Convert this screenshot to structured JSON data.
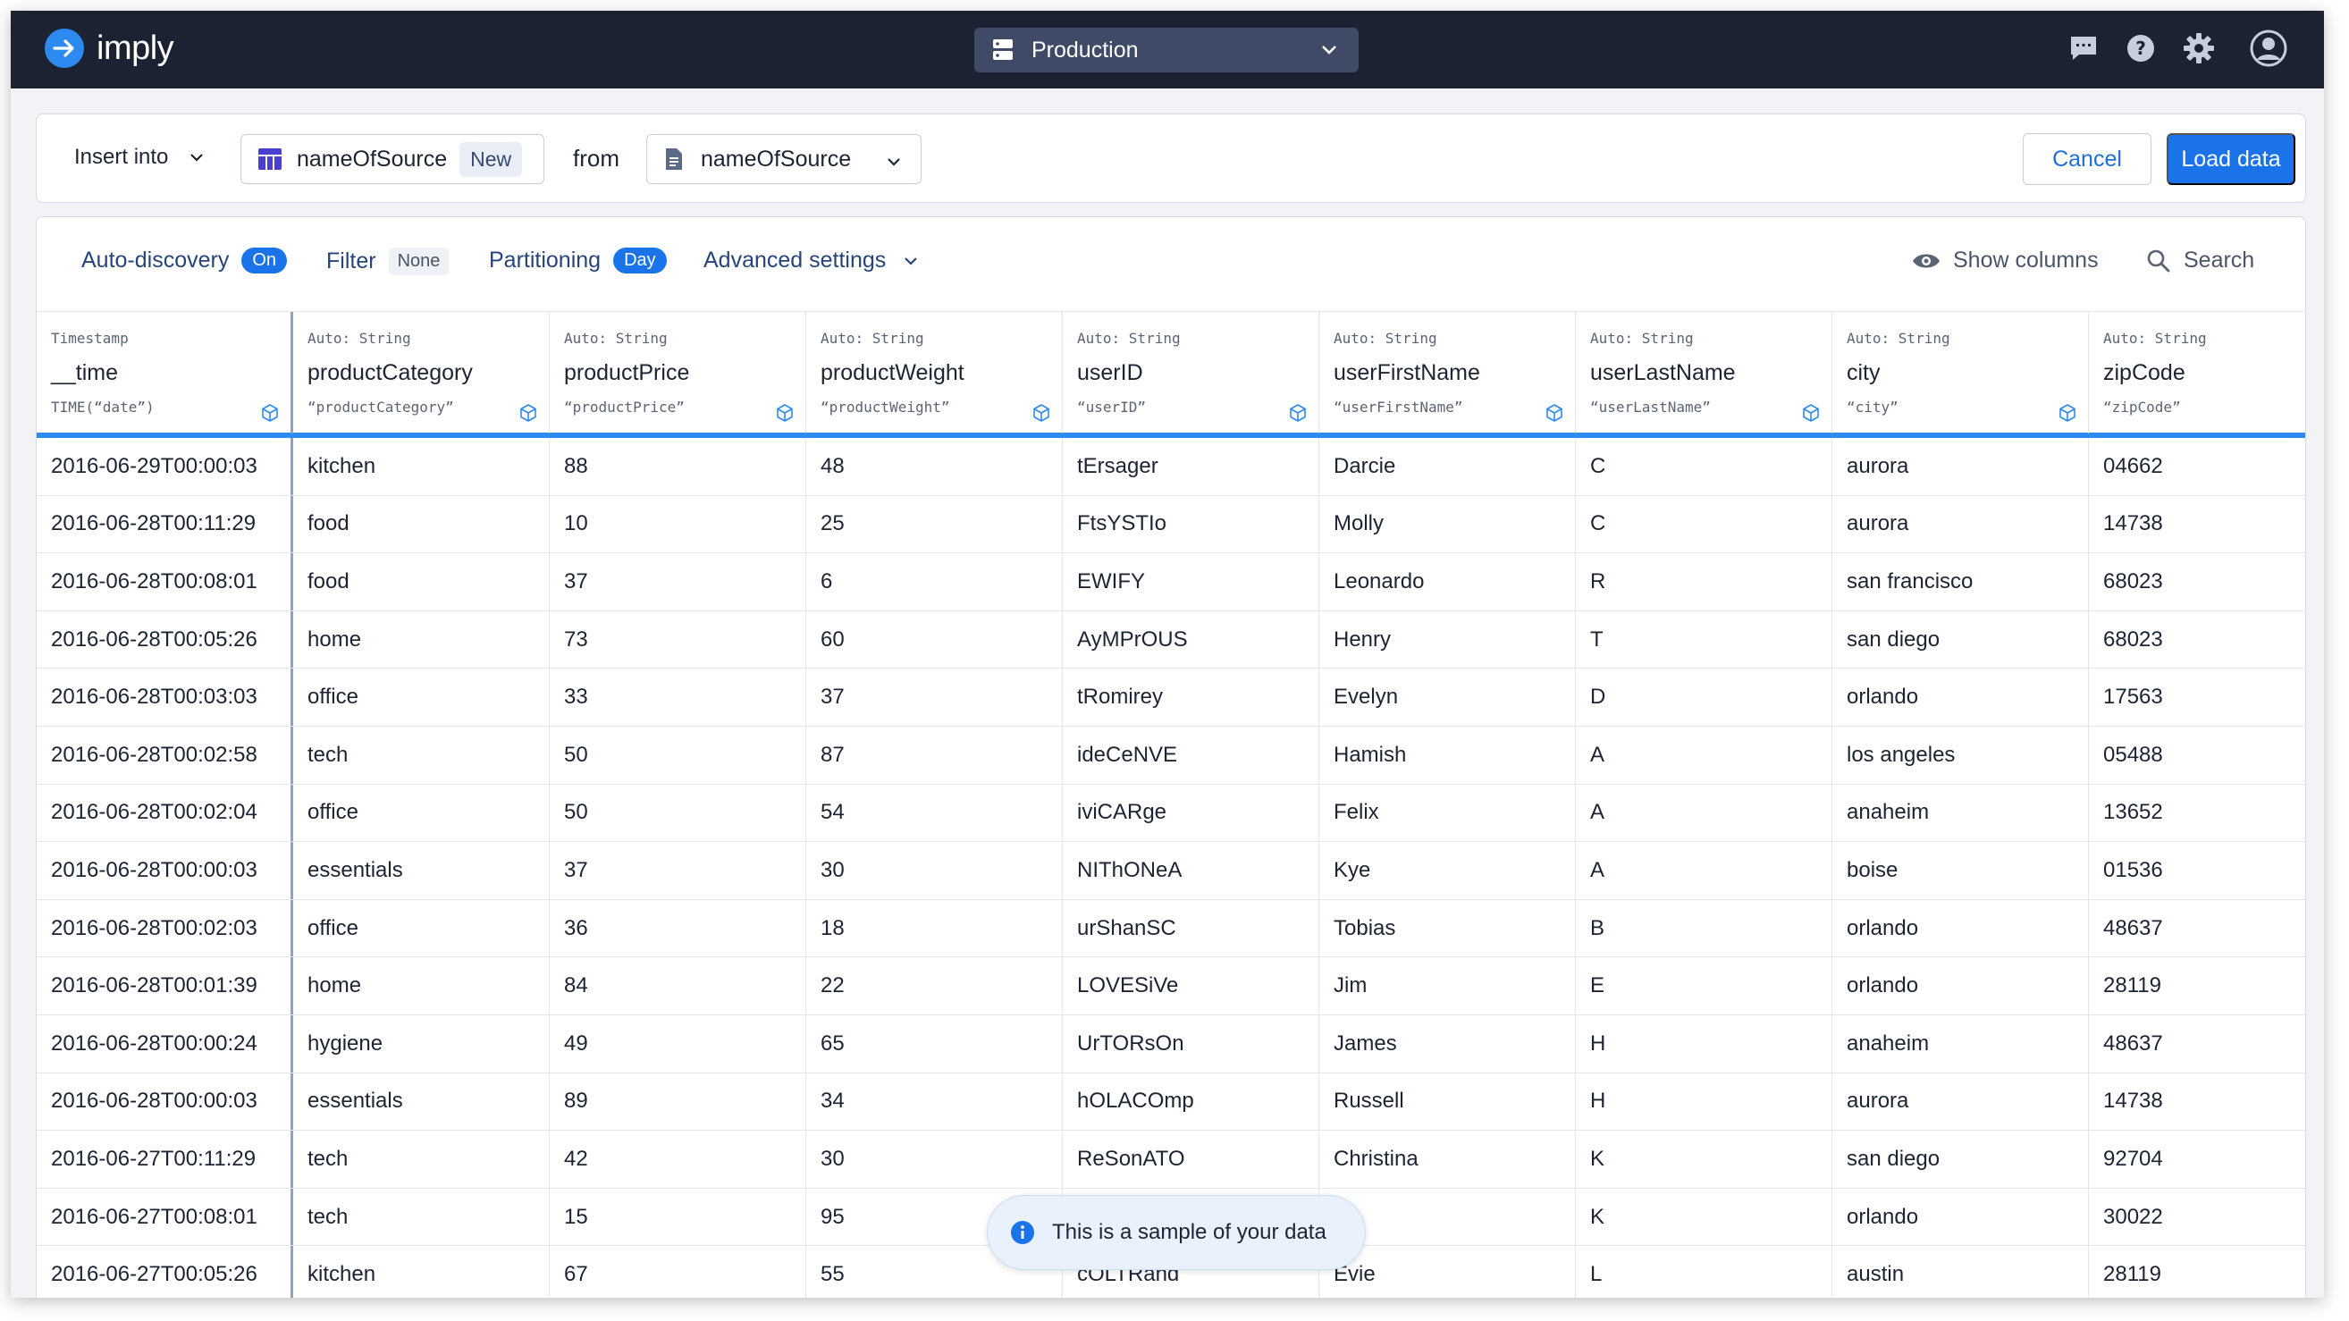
{
  "app": {
    "name": "imply"
  },
  "header": {
    "environment": "Production"
  },
  "insert_bar": {
    "insert_label": "Insert into",
    "target_table": "nameOfSource",
    "new_badge": "New",
    "from_label": "from",
    "source": "nameOfSource",
    "cancel_label": "Cancel",
    "load_label": "Load data"
  },
  "toolbar": {
    "auto_discovery": "Auto-discovery",
    "auto_discovery_state": "On",
    "filter": "Filter",
    "filter_state": "None",
    "partitioning": "Partitioning",
    "partitioning_state": "Day",
    "advanced": "Advanced settings",
    "show_columns": "Show columns",
    "search": "Search"
  },
  "columns": [
    {
      "type": "Timestamp",
      "name": "__time",
      "expr": "TIME(“date”)"
    },
    {
      "type": "Auto: String",
      "name": "productCategory",
      "expr": "“productCategory”"
    },
    {
      "type": "Auto: String",
      "name": "productPrice",
      "expr": "“productPrice”"
    },
    {
      "type": "Auto: String",
      "name": "productWeight",
      "expr": "“productWeight”"
    },
    {
      "type": "Auto: String",
      "name": "userID",
      "expr": "“userID”"
    },
    {
      "type": "Auto: String",
      "name": "userFirstName",
      "expr": "“userFirstName”"
    },
    {
      "type": "Auto: String",
      "name": "userLastName",
      "expr": "“userLastName”"
    },
    {
      "type": "Auto: String",
      "name": "city",
      "expr": "“city”"
    },
    {
      "type": "Auto: String",
      "name": "zipCode",
      "expr": "“zipCode”"
    }
  ],
  "rows": [
    [
      "2016-06-29T00:00:03",
      "kitchen",
      "88",
      "48",
      "tErsager",
      "Darcie",
      "C",
      "aurora",
      "04662"
    ],
    [
      "2016-06-28T00:11:29",
      "food",
      "10",
      "25",
      "FtsYSTIo",
      "Molly",
      "C",
      "aurora",
      "14738"
    ],
    [
      "2016-06-28T00:08:01",
      "food",
      "37",
      "6",
      "EWIFY",
      "Leonardo",
      "R",
      "san francisco",
      "68023"
    ],
    [
      "2016-06-28T00:05:26",
      "home",
      "73",
      "60",
      "AyMPrOUS",
      "Henry",
      "T",
      "san diego",
      "68023"
    ],
    [
      "2016-06-28T00:03:03",
      "office",
      "33",
      "37",
      "tRomirey",
      "Evelyn",
      "D",
      "orlando",
      "17563"
    ],
    [
      "2016-06-28T00:02:58",
      "tech",
      "50",
      "87",
      "ideCeNVE",
      "Hamish",
      "A",
      "los angeles",
      "05488"
    ],
    [
      "2016-06-28T00:02:04",
      "office",
      "50",
      "54",
      "iviCARge",
      "Felix",
      "A",
      "anaheim",
      "13652"
    ],
    [
      "2016-06-28T00:00:03",
      "essentials",
      "37",
      "30",
      "NIThONeA",
      "Kye",
      "A",
      "boise",
      "01536"
    ],
    [
      "2016-06-28T00:02:03",
      "office",
      "36",
      "18",
      "urShanSC",
      "Tobias",
      "B",
      "orlando",
      "48637"
    ],
    [
      "2016-06-28T00:01:39",
      "home",
      "84",
      "22",
      "LOVESiVe",
      "Jim",
      "E",
      "orlando",
      "28119"
    ],
    [
      "2016-06-28T00:00:24",
      "hygiene",
      "49",
      "65",
      "UrTORsOn",
      "James",
      "H",
      "anaheim",
      "48637"
    ],
    [
      "2016-06-28T00:00:03",
      "essentials",
      "89",
      "34",
      "hOLACOmp",
      "Russell",
      "H",
      "aurora",
      "14738"
    ],
    [
      "2016-06-27T00:11:29",
      "tech",
      "42",
      "30",
      "ReSonATO",
      "Christina",
      "K",
      "san diego",
      "92704"
    ],
    [
      "2016-06-27T00:08:01",
      "tech",
      "15",
      "95",
      "",
      "na",
      "K",
      "orlando",
      "30022"
    ],
    [
      "2016-06-27T00:05:26",
      "kitchen",
      "67",
      "55",
      "cOLTRand",
      "Evie",
      "L",
      "austin",
      "28119"
    ]
  ],
  "toast": {
    "text": "This is a sample of your data"
  },
  "colors": {
    "topbar": "#1b2232",
    "accent": "#1a73e8",
    "header_rule": "#2d8af0"
  }
}
